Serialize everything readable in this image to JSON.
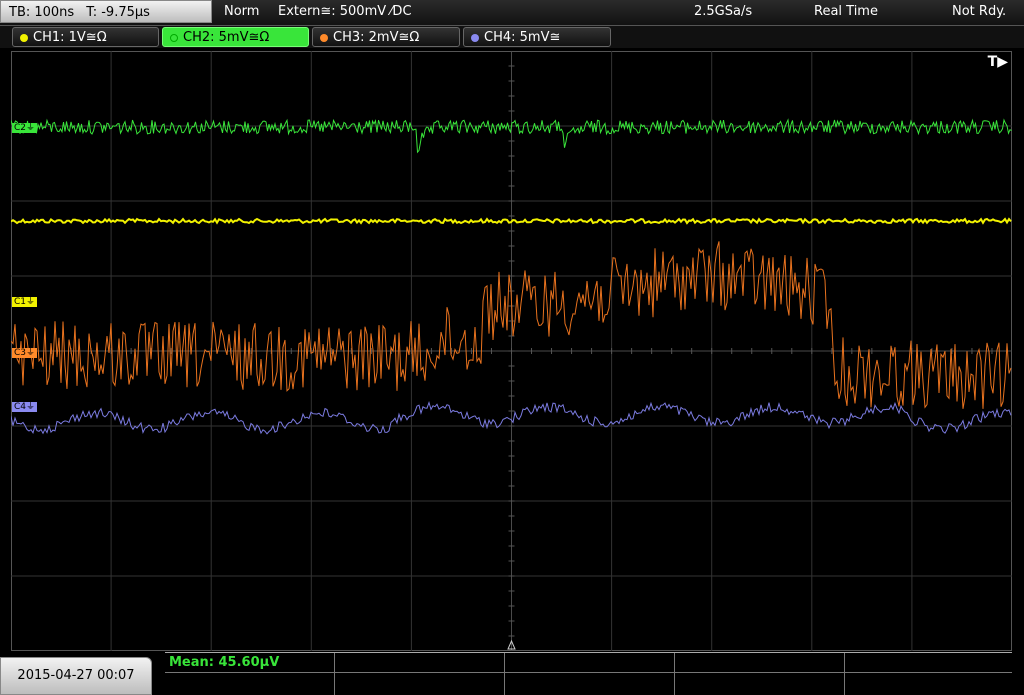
{
  "topbar": {
    "timebase": "TB: 100ns",
    "offset": "T: -9.75µs",
    "trigger_mode": "Norm",
    "trigger_source": "Extern≅: 500mV ⁄DC",
    "sample_rate": "2.5GSa/s",
    "acq_mode": "Real Time",
    "state": "Not Rdy."
  },
  "channels": [
    {
      "label": "CH1: 1V≅Ω",
      "color": "#f2f200"
    },
    {
      "label": "CH2: 5mV≅Ω",
      "color": "#39e53a"
    },
    {
      "label": "CH3: 2mV≅Ω",
      "color": "#ff8a2a"
    },
    {
      "label": "CH4: 5mV≅",
      "color": "#8a8af0"
    }
  ],
  "markers": {
    "c1": "C1⏚",
    "c2": "C2⏚",
    "c3": "C3⏚",
    "c4": "C4⏚",
    "trigger": "T▶"
  },
  "measurement": {
    "mean": "Mean: 45.60µV"
  },
  "datetime": "2015-04-27 00:07",
  "colors": {
    "ch1": "#f2f200",
    "ch2": "#39e53a",
    "ch3": "#e8721e",
    "ch4": "#7b7be0",
    "grid": "#3a3a3a"
  },
  "icons": {
    "channel_dot": "filled-circle",
    "trigger_arrow": "triangle-right"
  }
}
